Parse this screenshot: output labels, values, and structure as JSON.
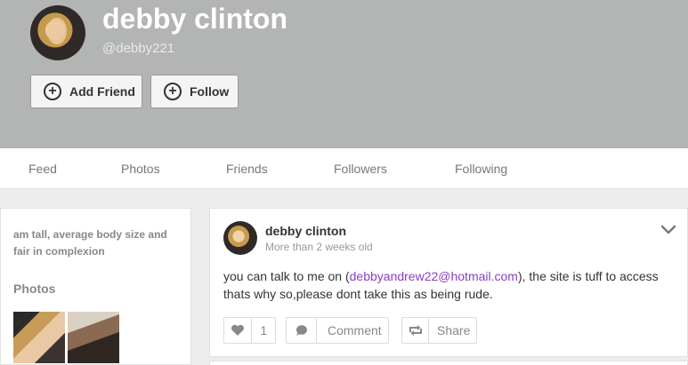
{
  "profile": {
    "name": "debby clinton",
    "handle": "@debby221",
    "add_friend_label": "Add Friend",
    "follow_label": "Follow"
  },
  "nav": {
    "items": [
      "Feed",
      "Photos",
      "Friends",
      "Followers",
      "Following"
    ]
  },
  "sidebar": {
    "bio": "am tall, average body size and fair in complexion",
    "photos_title": "Photos"
  },
  "post": {
    "author": "debby clinton",
    "time": "More than 2 weeks old",
    "text_before": "you can talk to me on (",
    "link": "debbyandrew22@hotmail.com",
    "text_after": "), the site is tuff to access thats why so,please dont take this as being rude.",
    "like_count": "1",
    "comment_label": "Comment",
    "share_label": "Share"
  },
  "colors": {
    "cover": "#b3b4b4",
    "link": "#8a3fbf"
  },
  "icons": {
    "like": "heart-icon",
    "comment": "comment-bubble-icon",
    "share": "retweet-icon",
    "menu": "chevron-down-icon"
  }
}
